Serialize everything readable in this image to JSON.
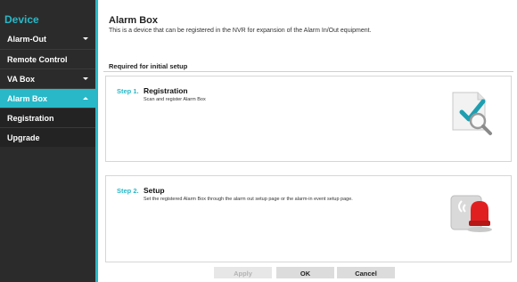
{
  "sidebar": {
    "title": "Device",
    "items": [
      {
        "label": "Alarm-Out",
        "arrow": "down"
      },
      {
        "label": "Remote Control"
      },
      {
        "label": "VA Box",
        "arrow": "down"
      },
      {
        "label": "Alarm Box",
        "arrow": "up",
        "active": true
      },
      {
        "label": "Registration",
        "sub": true
      },
      {
        "label": "Upgrade",
        "sub": true
      }
    ]
  },
  "main": {
    "title": "Alarm Box",
    "description": "This is a device that can be registered in the NVR for expansion of the Alarm In/Out equipment.",
    "section_label": "Required for initial setup",
    "steps": [
      {
        "number": "Step 1.",
        "title": "Registration",
        "description": "Scan and register Alarm Box",
        "icon": "document-check-search-icon"
      },
      {
        "number": "Step 2.",
        "title": "Setup",
        "description": "Set the registered Alarm Box through the alarm out setup page or the alarm-in event setup page.",
        "icon": "alarm-siren-icon"
      }
    ]
  },
  "footer": {
    "apply": "Apply",
    "ok": "OK",
    "cancel": "Cancel"
  },
  "colors": {
    "accent": "#28b8c8",
    "sidebar_bg": "#2b2b2b",
    "siren_red": "#e02020"
  }
}
